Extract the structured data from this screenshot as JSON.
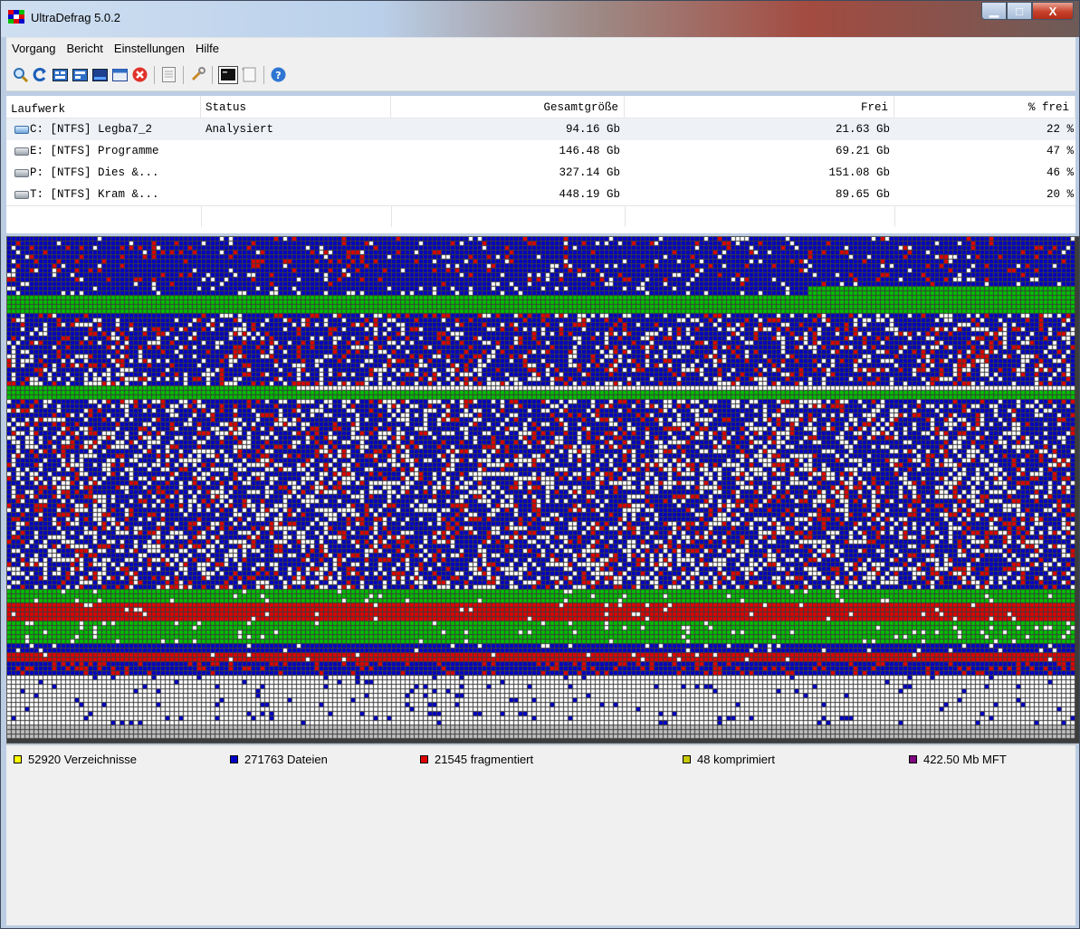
{
  "window": {
    "title": "UltraDefrag 5.0.2",
    "buttons": {
      "minimize": "▁",
      "maximize": "□",
      "close": "X"
    }
  },
  "menu": {
    "items": [
      "Vorgang",
      "Bericht",
      "Einstellungen",
      "Hilfe"
    ]
  },
  "toolbar": {
    "icons": [
      "analyze-icon",
      "defragment-icon",
      "quick-optimize-icon",
      "optimize-mft-icon",
      "full-optimize-icon",
      "repeat-icon",
      "stop-icon",
      "report-icon",
      "settings-icon",
      "boot-time-icon",
      "boot-script-icon",
      "help-icon"
    ]
  },
  "drives": {
    "headers": [
      "Laufwerk",
      "Status",
      "Gesamtgröße",
      "Frei",
      "% frei"
    ],
    "rows": [
      {
        "drive": "C: [NTFS]  Legba7_2",
        "status": "Analysiert",
        "total": "94.16 Gb",
        "free": "21.63 Gb",
        "pct": "22 %",
        "selected": true
      },
      {
        "drive": "E: [NTFS]  Programme",
        "status": "",
        "total": "146.48 Gb",
        "free": "69.21 Gb",
        "pct": "47 %",
        "selected": false
      },
      {
        "drive": "P: [NTFS]  Dies &...",
        "status": "",
        "total": "327.14 Gb",
        "free": "151.08 Gb",
        "pct": "46 %",
        "selected": false
      },
      {
        "drive": "T: [NTFS]  Kram &...",
        "status": "",
        "total": "448.19 Gb",
        "free": "89.65 Gb",
        "pct": "20 %",
        "selected": false
      }
    ]
  },
  "cluster_map": {
    "colors": {
      "files": "#0000c8",
      "fragmented": "#e00000",
      "free": "#ffffff",
      "system": "#00c000",
      "directories": "#ffff00",
      "mft": "#a000a0",
      "unused": "#c0c0c0",
      "grid": "#3c3c3c"
    }
  },
  "status": {
    "directories": "52920 Verzeichnisse",
    "files": "271763 Dateien",
    "fragmented": "21545 fragmentiert",
    "compressed": "48 komprimiert",
    "mft": "422.50 Mb MFT",
    "colors": {
      "directories": "#ffff00",
      "files": "#0000c8",
      "fragmented": "#e00000",
      "compressed": "#c8c800",
      "mft": "#800080"
    }
  }
}
